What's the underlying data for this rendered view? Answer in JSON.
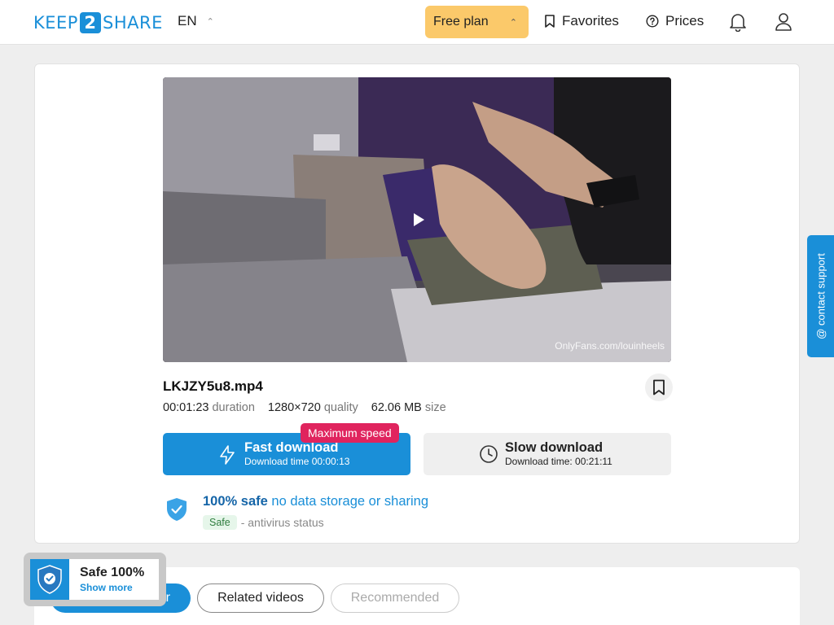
{
  "header": {
    "logo": {
      "before": "KEEP",
      "num": "2",
      "after": "SHARE"
    },
    "language": "EN",
    "plan_label": "Free plan",
    "favorites_label": "Favorites",
    "prices_label": "Prices",
    "icons": {
      "bookmark": "bookmark-icon",
      "help": "question-circle-icon",
      "bell": "bell-icon",
      "user": "user-icon"
    }
  },
  "file": {
    "name": "LKJZY5u8.mp4",
    "duration_value": "00:01:23",
    "duration_label": "duration",
    "quality_value": "1280×720",
    "quality_label": "quality",
    "size_value": "62.06 MB",
    "size_label": "size",
    "watermark": "OnlyFans.com/louinheels"
  },
  "download": {
    "fast_title": "Fast download",
    "fast_sub": "Download time 00:00:13",
    "max_badge": "Maximum speed",
    "slow_title": "Slow download",
    "slow_sub": "Download time: 00:21:11"
  },
  "safety": {
    "strong": "100% safe",
    "rest": "no data storage or sharing",
    "badge": "Safe",
    "status": "- antivirus status"
  },
  "support_label": "@ contact support",
  "tabs": [
    "From this partner",
    "Related videos",
    "Recommended"
  ],
  "safe_widget": {
    "title": "Safe 100%",
    "link": "Show more"
  },
  "colors": {
    "brand": "#1a8fd8",
    "plan": "#fbc96a",
    "badge": "#e0245e"
  }
}
